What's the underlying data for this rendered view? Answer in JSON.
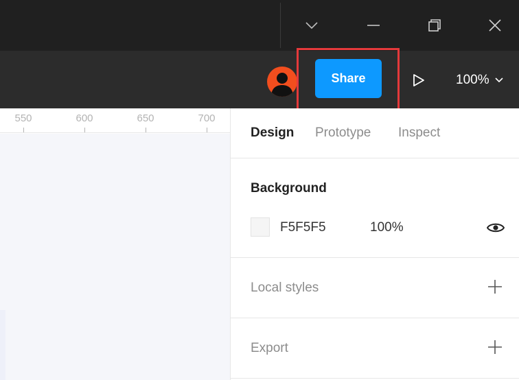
{
  "window": {
    "controls": [
      "chevron-down",
      "minimize",
      "restore",
      "close"
    ]
  },
  "toolbar": {
    "share_label": "Share",
    "zoom_label": "100%",
    "colors": {
      "share_bg": "#0d99ff",
      "avatar_bg": "#f24e1e",
      "highlight": "#e5393b"
    }
  },
  "ruler": {
    "ticks": [
      "550",
      "600",
      "650",
      "700"
    ]
  },
  "panel": {
    "tabs": [
      {
        "label": "Design",
        "active": true
      },
      {
        "label": "Prototype",
        "active": false
      },
      {
        "label": "Inspect",
        "active": false
      }
    ],
    "background": {
      "title": "Background",
      "hex": "F5F5F5",
      "opacity": "100%",
      "swatch_color": "#F5F5F5"
    },
    "local_styles": {
      "label": "Local styles"
    },
    "export": {
      "label": "Export"
    }
  }
}
